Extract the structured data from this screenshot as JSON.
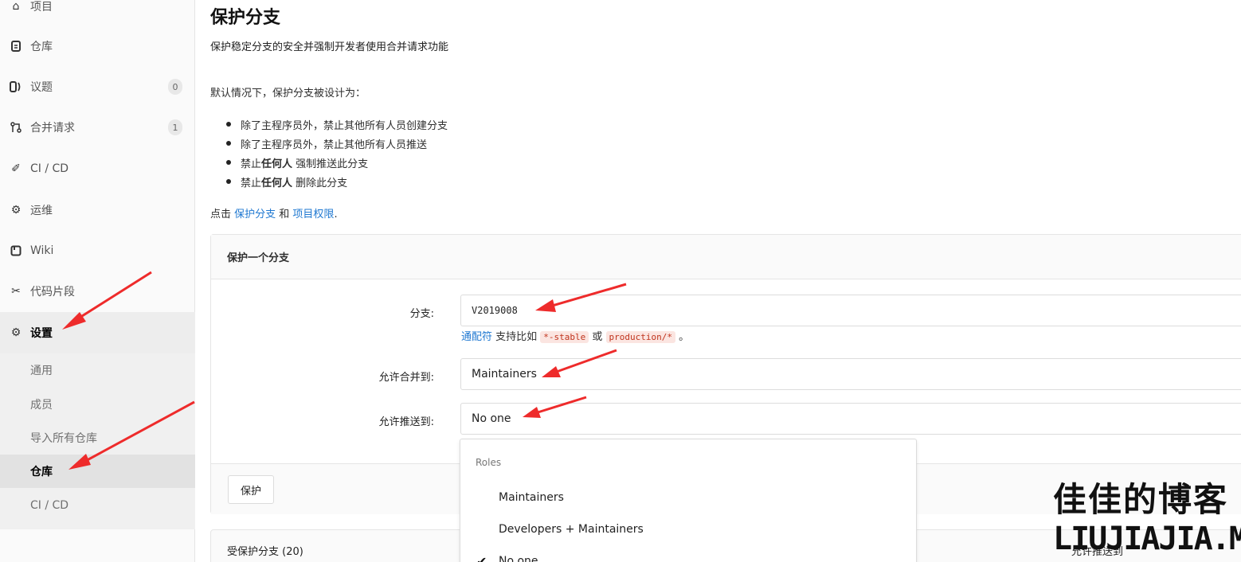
{
  "sidebar": {
    "items": [
      {
        "label": "项目",
        "icon": "project-icon"
      },
      {
        "label": "仓库",
        "icon": "repository-icon"
      },
      {
        "label": "议题",
        "icon": "issues-icon",
        "count": "0"
      },
      {
        "label": "合并请求",
        "icon": "merge-request-icon",
        "count": "1"
      },
      {
        "label": "CI / CD",
        "icon": "rocket-icon"
      },
      {
        "label": "运维",
        "icon": "operations-icon"
      },
      {
        "label": "Wiki",
        "icon": "book-icon"
      },
      {
        "label": "代码片段",
        "icon": "scissors-icon"
      },
      {
        "label": "设置",
        "icon": "gear-icon"
      }
    ],
    "settings_sub": [
      "通用",
      "成员",
      "导入所有仓库",
      "仓库",
      "CI / CD"
    ]
  },
  "page": {
    "title": "保护分支",
    "description": "保护稳定分支的安全并强制开发者使用合并请求功能",
    "intro": "默认情况下，保护分支被设计为：",
    "bullets": {
      "b1": "除了主程序员外，禁止其他所有人员创建分支",
      "b2": "除了主程序员外，禁止其他所有人员推送",
      "b3_pre": "禁止",
      "b3_bold": "任何人",
      "b3_post": " 强制推送此分支",
      "b4_pre": "禁止",
      "b4_bold": "任何人",
      "b4_post": " 删除此分支"
    },
    "hint_pre": "点击 ",
    "hint_link1": "保护分支",
    "hint_mid": " 和 ",
    "hint_link2": "项目权限",
    "hint_post": "."
  },
  "form": {
    "header": "保护一个分支",
    "branch_label": "分支:",
    "branch_value": "V2019008",
    "help_link": "通配符",
    "help_mid": " 支持比如 ",
    "help_code1": "*-stable",
    "help_or": " 或 ",
    "help_code2": "production/*",
    "help_end": " 。",
    "merge_label": "允许合并到:",
    "merge_value": "Maintainers",
    "push_label": "允许推送到:",
    "push_value": "No one",
    "submit_label": "保护"
  },
  "dropdown": {
    "header": "Roles",
    "options": [
      "Maintainers",
      "Developers + Maintainers",
      "No one"
    ],
    "selected": "No one"
  },
  "protected": {
    "title": "受保护分支 (20)",
    "right_label": "允许推送到"
  },
  "watermark": {
    "line1": "佳佳的博客",
    "line2": "LIUJIAJIA.ME"
  },
  "colors": {
    "link": "#1f78d1",
    "arrow": "#ee2b2b"
  }
}
